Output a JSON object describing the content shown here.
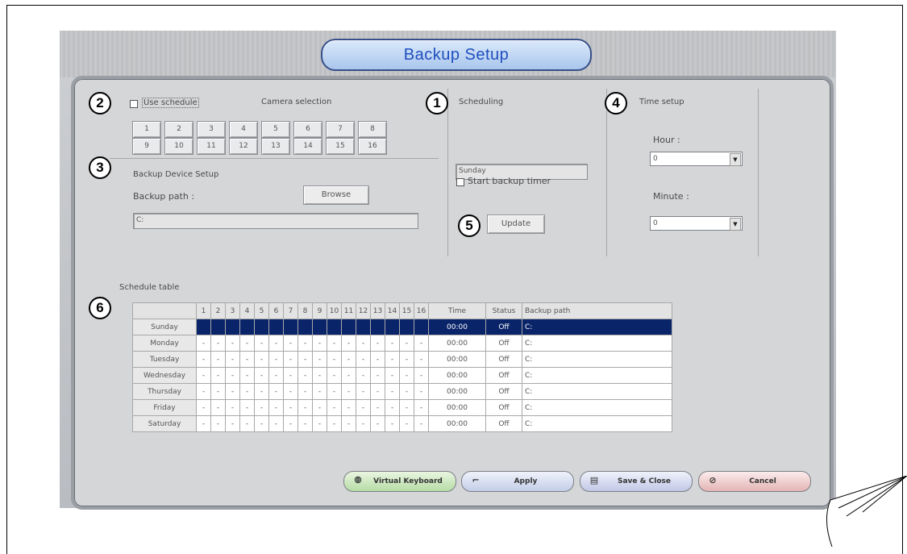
{
  "window": {
    "title": "Backup Setup"
  },
  "annotations": [
    "1",
    "2",
    "3",
    "4",
    "5",
    "6"
  ],
  "camera_selection": {
    "use_schedule_label": "Use schedule",
    "heading": "Camera selection",
    "row1": [
      "1",
      "2",
      "3",
      "4",
      "5",
      "6",
      "7",
      "8"
    ],
    "row2": [
      "9",
      "10",
      "11",
      "12",
      "13",
      "14",
      "15",
      "16"
    ]
  },
  "backup_device": {
    "heading": "Backup Device Setup",
    "path_label": "Backup path :",
    "browse_label": "Browse",
    "path_value": "C:"
  },
  "scheduling": {
    "heading": "Scheduling",
    "day_value": "Sunday",
    "start_timer_label": "Start backup timer",
    "update_label": "Update"
  },
  "time_setup": {
    "heading": "Time setup",
    "hour_label": "Hour :",
    "hour_value": "0",
    "minute_label": "Minute :",
    "minute_value": "0"
  },
  "schedule_table": {
    "label": "Schedule table",
    "headers": [
      "1",
      "2",
      "3",
      "4",
      "5",
      "6",
      "7",
      "8",
      "9",
      "10",
      "11",
      "12",
      "13",
      "14",
      "15",
      "16"
    ],
    "time_header": "Time",
    "status_header": "Status",
    "path_header": "Backup path",
    "rows": [
      {
        "day": "Sunday",
        "cell": "",
        "time": "00:00",
        "status": "Off",
        "path": "C:"
      },
      {
        "day": "Monday",
        "cell": "-",
        "time": "00:00",
        "status": "Off",
        "path": "C:"
      },
      {
        "day": "Tuesday",
        "cell": "-",
        "time": "00:00",
        "status": "Off",
        "path": "C:"
      },
      {
        "day": "Wednesday",
        "cell": "-",
        "time": "00:00",
        "status": "Off",
        "path": "C:"
      },
      {
        "day": "Thursday",
        "cell": "-",
        "time": "00:00",
        "status": "Off",
        "path": "C:"
      },
      {
        "day": "Friday",
        "cell": "-",
        "time": "00:00",
        "status": "Off",
        "path": "C:"
      },
      {
        "day": "Saturday",
        "cell": "-",
        "time": "00:00",
        "status": "Off",
        "path": "C:"
      }
    ]
  },
  "footer": {
    "virtual_keyboard": "Virtual Keyboard",
    "apply": "Apply",
    "save_close": "Save & Close",
    "cancel": "Cancel"
  },
  "colors": {
    "title_text": "#1f4fbf",
    "selected_row": "#0a246a"
  }
}
